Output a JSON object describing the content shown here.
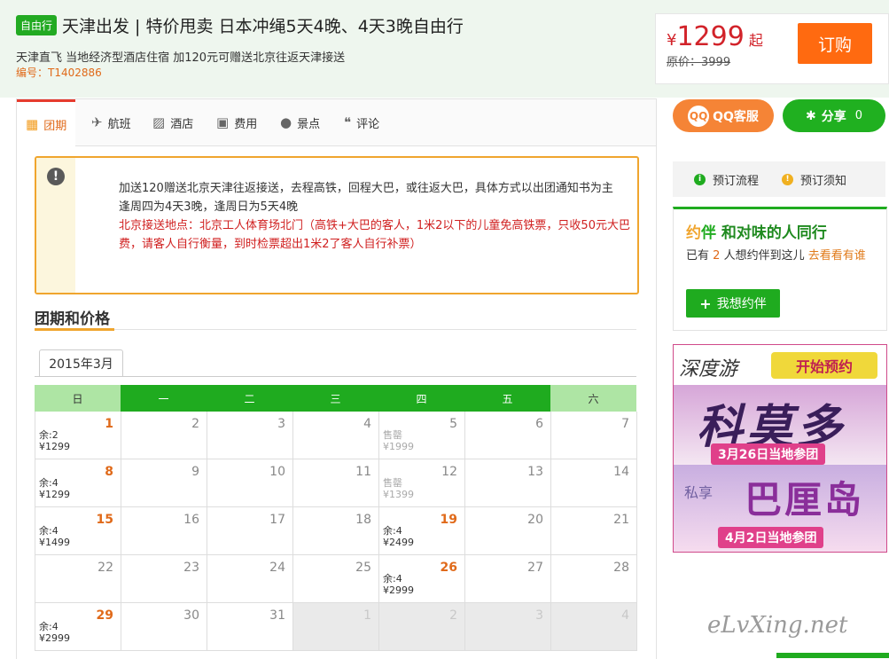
{
  "header": {
    "tag": "自由行",
    "title": "天津出发 | 特价甩卖 日本冲绳5天4晚、4天3晚自由行",
    "subtitle": "天津直飞 当地经济型酒店住宿 加120元可赠送北京往返天津接送",
    "code": "编号：T1402886"
  },
  "price": {
    "currency": "¥",
    "amount": "1299",
    "suffix": "起",
    "original": "原价：3999",
    "order_label": "订购"
  },
  "tabs": [
    {
      "label": "团期",
      "icon": "calendar-icon",
      "active": true
    },
    {
      "label": "航班",
      "icon": "plane-icon"
    },
    {
      "label": "酒店",
      "icon": "bed-icon"
    },
    {
      "label": "费用",
      "icon": "wallet-icon"
    },
    {
      "label": "景点",
      "icon": "location-icon"
    },
    {
      "label": "评论",
      "icon": "quote-icon"
    }
  ],
  "notice": {
    "line1": "加送120赠送北京天津往返接送，去程高铁，回程大巴，或往返大巴，具体方式以出团通知书为主",
    "line2": "逢周四为4天3晚，逢周日为5天4晚",
    "line3": "北京接送地点：北京工人体育场北门（高铁+大巴的客人，1米2以下的儿童免高铁票，只收50元大巴费，请客人自行衡量，到时检票超出1米2了客人自行补票）"
  },
  "section": {
    "title": "团期和价格",
    "month": "2015年3月"
  },
  "calendar": {
    "weekdays": [
      "日",
      "一",
      "二",
      "三",
      "四",
      "五",
      "六"
    ],
    "weeks": [
      [
        {
          "d": "1",
          "hl": true,
          "a": "余:2",
          "b": "¥1299"
        },
        {
          "d": "2"
        },
        {
          "d": "3"
        },
        {
          "d": "4"
        },
        {
          "d": "5",
          "sold": true,
          "a": "售罄",
          "b": "¥1999"
        },
        {
          "d": "6"
        },
        {
          "d": "7"
        }
      ],
      [
        {
          "d": "8",
          "hl": true,
          "a": "余:4",
          "b": "¥1299"
        },
        {
          "d": "9"
        },
        {
          "d": "10"
        },
        {
          "d": "11"
        },
        {
          "d": "12",
          "sold": true,
          "a": "售罄",
          "b": "¥1399"
        },
        {
          "d": "13"
        },
        {
          "d": "14"
        }
      ],
      [
        {
          "d": "15",
          "hl": true,
          "a": "余:4",
          "b": "¥1499"
        },
        {
          "d": "16"
        },
        {
          "d": "17"
        },
        {
          "d": "18"
        },
        {
          "d": "19",
          "hl": true,
          "a": "余:4",
          "b": "¥2499"
        },
        {
          "d": "20"
        },
        {
          "d": "21"
        }
      ],
      [
        {
          "d": "22"
        },
        {
          "d": "23"
        },
        {
          "d": "24"
        },
        {
          "d": "25"
        },
        {
          "d": "26",
          "hl": true,
          "a": "余:4",
          "b": "¥2999"
        },
        {
          "d": "27"
        },
        {
          "d": "28"
        }
      ],
      [
        {
          "d": "29",
          "hl": true,
          "a": "余:4",
          "b": "¥2999"
        },
        {
          "d": "30"
        },
        {
          "d": "31"
        },
        {
          "d": "1",
          "next": true
        },
        {
          "d": "2",
          "next": true
        },
        {
          "d": "3",
          "next": true
        },
        {
          "d": "4",
          "next": true
        }
      ]
    ]
  },
  "sidebar": {
    "cs_label": "QQ客服",
    "cs_icon_text": "QQ",
    "share_label": "分享",
    "share_count": "0",
    "process_label": "预订流程",
    "notes_label": "预订须知",
    "yueban_logo_a": "约",
    "yueban_logo_b": "伴",
    "yueban_title": "和对味的人同行",
    "yueban_text_pre": "已有",
    "yueban_count": "2",
    "yueban_text_mid": "人想约伴到这儿",
    "yueban_link": "去看看有谁",
    "yueban_btn": "我想约伴"
  },
  "ad": {
    "brand": "深度游",
    "start": "开始预约",
    "big1": "科莫多",
    "date1": "3月26日当地参团",
    "small2": "私享",
    "big2": "巴厘岛",
    "date2": "4月2日当地参团"
  },
  "watermark": "eLvXing.net",
  "colors": {
    "accent_green": "#1fab1f",
    "accent_orange": "#ff6a10",
    "price_red": "#d2232a",
    "notice_border": "#f0a52e"
  }
}
